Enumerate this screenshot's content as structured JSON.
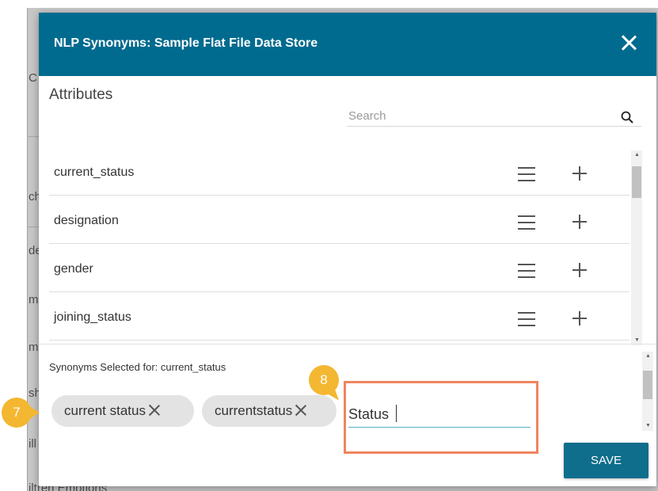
{
  "dialog": {
    "title": "NLP Synonyms: Sample Flat File Data Store",
    "close_icon": "close-icon"
  },
  "attributes": {
    "heading": "Attributes",
    "search_placeholder": "Search",
    "items": [
      {
        "label": "current_status"
      },
      {
        "label": "designation"
      },
      {
        "label": "gender"
      },
      {
        "label": "joining_status"
      }
    ]
  },
  "synonyms": {
    "heading": "Synonyms Selected for: current_status",
    "chips": [
      {
        "label": "current status"
      },
      {
        "label": "currentstatus"
      }
    ],
    "input_value": "Status"
  },
  "save_label": "SAVE",
  "callouts": {
    "chips_step": "7",
    "input_step": "8"
  },
  "background": {
    "fragments": [
      "C",
      "ch",
      "de",
      "m",
      "m",
      "sh",
      "ill",
      "iltren Emotions"
    ]
  },
  "colors": {
    "header": "#006b8f",
    "save_button": "#0f6e8c",
    "callout_badge": "#f4b731",
    "callout_box": "#f0855f",
    "input_underline": "#5ab0c4"
  }
}
